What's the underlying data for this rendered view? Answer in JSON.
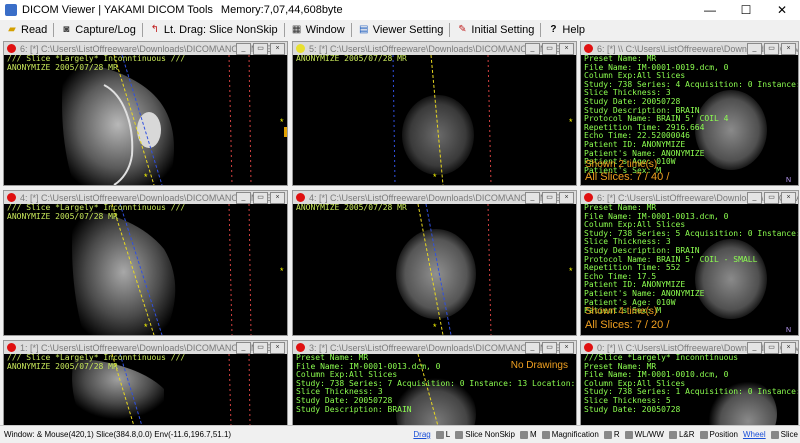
{
  "window": {
    "title": "DICOM Viewer | YAKAMI DICOM Tools",
    "memory": "Memory:7,07,44,608byte",
    "minimize": "—",
    "maximize": "☐",
    "close": "✕"
  },
  "toolbar": {
    "items": [
      {
        "label": "Read",
        "icon": "folder-icon"
      },
      {
        "label": "Capture/Log",
        "icon": "camera-icon"
      },
      {
        "label": "Lt. Drag: Slice NonSkip",
        "icon": "drag-icon"
      },
      {
        "label": "Window",
        "icon": "window-icon"
      },
      {
        "label": "Viewer Setting",
        "icon": "viewer-icon"
      },
      {
        "label": "Initial Setting",
        "icon": "setting-icon"
      },
      {
        "label": "Help",
        "icon": "help-icon"
      }
    ]
  },
  "panels": [
    {
      "title": "6: [*] C:\\Users\\ListOffreeware\\Downloads\\DICOM\\ANONYMIZE",
      "dot": "#e01010",
      "overlay": "/// Slice *Largely* Inconntinuous ///\nANONYMIZE 2005/07/28 MR",
      "overlay_style": "yellow",
      "view": "sagittal"
    },
    {
      "title": "5: [*] C:\\Users\\ListOffreeware\\Downloads\\DICOM\\ANONYMIZE",
      "dot": "#e8e030",
      "overlay": "ANONYMIZE 2005/07/28 MR",
      "overlay_style": "yellow",
      "view": "axial-small"
    },
    {
      "title": "6: [*] \\\\ C:\\Users\\ListOffreeware\\Downloads\\DICOM\\",
      "dot": "#e01010",
      "overlay": "Preset Name: MR\nFile Name: IM-0001-0019.dcm, 0\nColumn Exp:All Slices\nStudy: 738 Series: 4 Acquisition: 0 Instance: 19 Location: -9.72\nSlice Thickness: 3\nStudy Date: 20050728\nStudy Description: BRAIN\nProtocol Name: BRAIN 5' COIL 4\nRepetition Time: 2916.664\nEcho Time: 22.52000046\nPatient ID: ANONYMIZE\nPatient's Name: ANONYMIZE\nPatient's Age: 010W\nPatient's Sex: M",
      "overlay_style": "green",
      "shown": "Shown 2 time(s)",
      "slices": "All Slices: 7 / 40 /",
      "view": "axial-info"
    },
    {
      "title": "4: [*] C:\\Users\\ListOffreeware\\Downloads\\DICOM\\ANONYMIZE",
      "dot": "#e01010",
      "overlay": "/// Slice *Largely* Inconntinuous ///\nANONYMIZE 2005/07/28 MR",
      "overlay_style": "yellow",
      "view": "sagittal"
    },
    {
      "title": "4: [*] C:\\Users\\ListOffreeware\\Downloads\\DICOM\\ANONYMIZE",
      "dot": "#e01010",
      "overlay": "ANONYMIZE 2005/07/28 MR",
      "overlay_style": "yellow",
      "view": "axial"
    },
    {
      "title": "6: [*] C:\\Users\\ListOffreeware\\Downloads\\DICOM\\ANONYMIZE",
      "dot": "#e01010",
      "overlay": "Preset Name: MR\nFile Name: IM-0001-0013.dcm, 0\nColumn Exp:All Slices\nStudy: 738 Series: 5 Acquisition: 0 Instance: 13 Location: -0.72\nSlice Thickness: 3\nStudy Description: BRAIN\nProtocol Name: BRAIN 5' COIL - SMALL\nRepetition Time: 552\nEcho Time: 17.5\nPatient ID: ANONYMIZE\nPatient's Name: ANONYMIZE\nPatient's Age: 010W\nPatient's Sex: M",
      "overlay_style": "green",
      "shown": "Shown 4 time(s)",
      "slices": "All Slices: 7 / 20 /",
      "view": "axial-info"
    },
    {
      "title": "1: [*] C:\\Users\\ListOffreeware\\Downloads\\DICOM\\ANONYMIZE",
      "dot": "#e01010",
      "overlay": "/// Slice *Largely* Inconntinuous ///\nANONYMIZE 2005/07/28 MR",
      "overlay_style": "yellow",
      "view": "sagittal"
    },
    {
      "title": "3: [*] C:\\Users\\ListOffreeware\\Downloads\\DICOM\\ANONYMIZE",
      "dot": "#e01010",
      "overlay": "Preset Name: MR\nFile Name: IM-0001-0013.dcm, 0\nColumn Exp:All Slices\nStudy: 738 Series: 7 Acquisition: 0 Instance: 13 Location: -0.72 Column: 1/1\nSlice Thickness: 3\nStudy Date: 20050728\nStudy Description: BRAIN",
      "overlay_style": "green",
      "nodraw": "No Drawings",
      "view": "axial"
    },
    {
      "title": "0: [*] \\\\ C:\\Users\\ListOffreeware\\Downloads\\DICOM\\ANONYMIZE",
      "dot": "#e01010",
      "overlay": "///Slice *Largely* Inconntinuous\nPreset Name: MR\nFile Name: IM-0001-0010.dcm, 0\nColumn Exp:All Slices\nStudy: 738 Series: 1 Acquisition: 0 Instance: 10 Location: 10.00\nSlice Thickness: 5\nStudy Date: 20050728",
      "overlay_style": "green",
      "view": "axial-info"
    }
  ],
  "status": {
    "left": "Window: & Mouse(420,1) Slice(384.8,0.0) Env(-11.6,196.7,51.1)",
    "drag": "Drag",
    "items": [
      "L",
      "Slice NonSkip",
      "M",
      "Magnification",
      "R",
      "WL/WW",
      "L&R",
      "Position",
      "Wheel",
      "Slice"
    ]
  }
}
